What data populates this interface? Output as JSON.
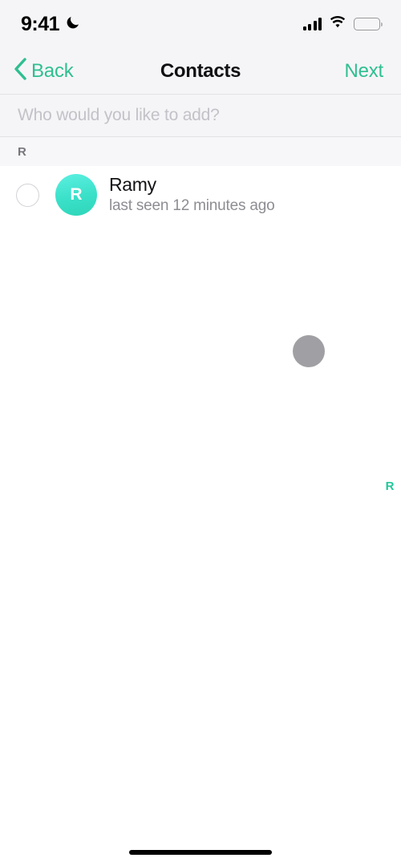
{
  "status_bar": {
    "time": "9:41",
    "dnd_icon": "crescent-moon-icon",
    "cellular_icon": "signal-bars-icon",
    "wifi_icon": "wifi-icon",
    "battery_icon": "battery-full-icon"
  },
  "nav_bar": {
    "back_label": "Back",
    "back_icon": "chevron-left-icon",
    "title": "Contacts",
    "next_label": "Next"
  },
  "search": {
    "value": "",
    "placeholder": "Who would you like to add?"
  },
  "sections": [
    {
      "header": "R",
      "contacts": [
        {
          "name": "Ramy",
          "status": "last seen 12 minutes ago",
          "avatar_initial": "R",
          "selected": false
        }
      ]
    }
  ],
  "index_scrubber": {
    "letters": [
      "R"
    ]
  },
  "overlay": {
    "bubble": "scroll-position-bubble"
  },
  "colors": {
    "accent": "#2fbf8f",
    "index_accent": "#22c79b",
    "avatar_start": "#5cf0e2",
    "avatar_end": "#2fd6b9",
    "bubble_gray": "#a0a0a4",
    "bar_background": "#f5f5f7",
    "section_background": "#f7f7f9"
  }
}
